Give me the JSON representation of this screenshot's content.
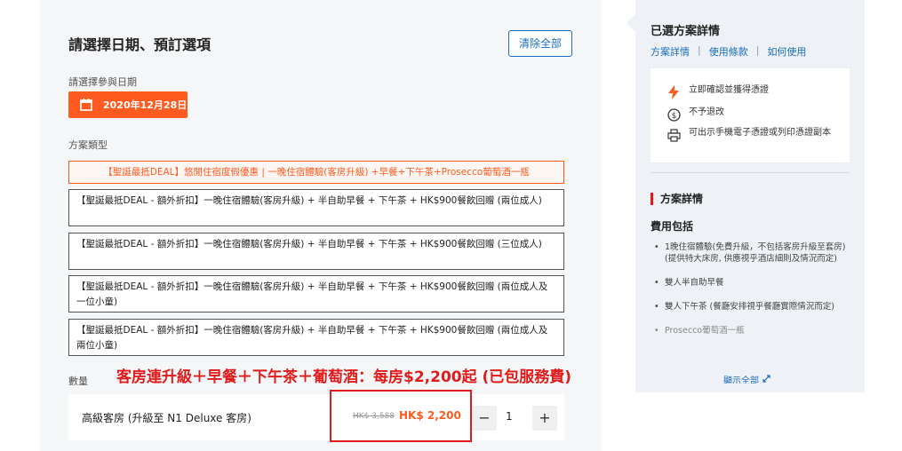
{
  "booking": {
    "title": "請選擇日期、預訂選項",
    "clear_all": "清除全部",
    "date_label": "請選擇參與日期",
    "date_value": "2020年12月28日",
    "plan_type_label": "方案類型",
    "options": [
      "【聖誕最抵DEAL】悠閒住宿度假優惠 | 一晚住宿體驗(客房升級) +早餐+下午茶+Prosecco葡萄酒一瓶",
      "【聖誕最抵DEAL - 額外折扣】一晚住宿體驗(客房升級) + 半自助早餐 + 下午茶 + HK$900餐飲回贈 (兩位成人)",
      "【聖誕最抵DEAL - 額外折扣】一晚住宿體驗(客房升級) + 半自助早餐 + 下午茶 + HK$900餐飲回贈 (三位成人)",
      "【聖誕最抵DEAL - 額外折扣】一晚住宿體驗(客房升級) + 半自助早餐 + 下午茶 + HK$900餐飲回贈 (兩位成人及一位小童)",
      "【聖誕最抵DEAL - 額外折扣】一晚住宿體驗(客房升級) + 半自助早餐 + 下午茶 + HK$900餐飲回贈 (兩位成人及兩位小童)"
    ],
    "qty_label": "數量",
    "room_name": "高級客房 (升級至 N1 Deluxe 客房)",
    "price_old": "HK$ 3,588",
    "price_new": "HK$ 2,200",
    "minus": "−",
    "quantity": "1",
    "plus": "+"
  },
  "annotation": "客房連升級＋早餐＋下午茶＋葡萄酒：每房$2,200起 (已包服務費)",
  "sidebar": {
    "title": "已選方案詳情",
    "links": [
      "方案詳情",
      "使用條款",
      "如何使用"
    ],
    "features": [
      {
        "icon": "lightning-icon",
        "text": "立即確認並獲得憑證"
      },
      {
        "icon": "no-refund-icon",
        "text": "不予退改"
      },
      {
        "icon": "printer-icon",
        "text": "可出示手機電子憑證或列印憑證副本"
      }
    ],
    "detail_heading": "方案詳情",
    "fee_heading": "費用包括",
    "bullets": [
      "1晚住宿體驗(免費升級，不包括客房升級至套房) (提供特大床房, 供應視乎酒店細則及情況而定)",
      "雙人半自助早餐",
      "雙人下午茶 (餐廳安排視乎餐廳實際情況而定)",
      "Prosecco葡萄酒一瓶"
    ],
    "expand_all": "顯示全部"
  },
  "colors": {
    "accent": "#ff5a1f",
    "link": "#1a6ec2",
    "annotation": "#e01b1b"
  }
}
